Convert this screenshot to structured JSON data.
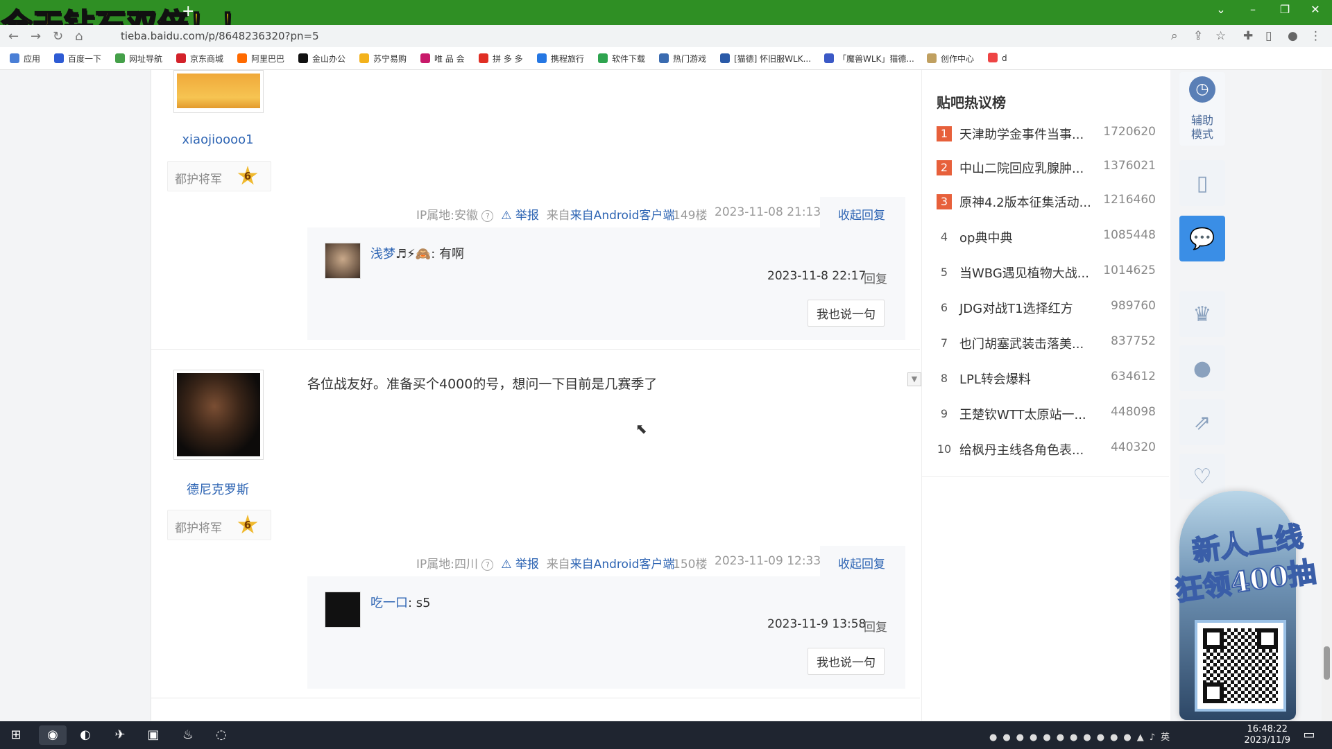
{
  "overlay_banner": "全天钻石双倍！！",
  "browser": {
    "url": "tieba.baidu.com/p/8648236320?pn=5",
    "bookmarks": [
      "应用",
      "百度一下",
      "网址导航",
      "京东商城",
      "阿里巴巴",
      "金山办公",
      "苏宁易购",
      "唯 品 会",
      "拼 多 多",
      "携程旅行",
      "软件下载",
      "热门游戏",
      "[猫德] 怀旧服WLK...",
      "「魔兽WLK」猫德...",
      "创作中心",
      "d"
    ]
  },
  "posts": [
    {
      "username": "xiaojioooo1",
      "badge": "都护将军",
      "level": "6",
      "ip": "IP属地:安徽",
      "report": "举报",
      "client": "来自Android客户端",
      "floor": "149楼",
      "time": "2023-11-08 21:13",
      "collapse": "收起回复",
      "replies": [
        {
          "name": "浅梦",
          "emoji": "♬⚡🙈",
          "text": ": 有啊",
          "time": "2023-11-8 22:17",
          "reply": "回复"
        }
      ],
      "say": "我也说一句"
    },
    {
      "username": "德尼克罗斯",
      "badge": "都护将军",
      "level": "6",
      "content": "各位战友好。准备买个4000的号，想问一下目前是几赛季了",
      "ip": "IP属地:四川",
      "report": "举报",
      "client": "来自Android客户端",
      "floor": "150楼",
      "time": "2023-11-09 12:33",
      "collapse": "收起回复",
      "replies": [
        {
          "name": "吃一口",
          "text": ": s5",
          "time": "2023-11-9 13:58",
          "reply": "回复"
        }
      ],
      "say": "我也说一句"
    }
  ],
  "sidebar": {
    "title": "贴吧热议榜",
    "items": [
      {
        "rank": "1",
        "topic": "天津助学金事件当事...",
        "count": "1720620"
      },
      {
        "rank": "2",
        "topic": "中山二院回应乳腺肿...",
        "count": "1376021"
      },
      {
        "rank": "3",
        "topic": "原神4.2版本征集活动...",
        "count": "1216460"
      },
      {
        "rank": "4",
        "topic": "op典中典",
        "count": "1085448"
      },
      {
        "rank": "5",
        "topic": "当WBG遇见植物大战...",
        "count": "1014625"
      },
      {
        "rank": "6",
        "topic": "JDG对战T1选择红方",
        "count": "989760"
      },
      {
        "rank": "7",
        "topic": "也门胡塞武装击落美...",
        "count": "837752"
      },
      {
        "rank": "8",
        "topic": "LPL转会爆料",
        "count": "634612"
      },
      {
        "rank": "9",
        "topic": "王楚钦WTT太原站一...",
        "count": "448098"
      },
      {
        "rank": "10",
        "topic": "给枫丹主线各角色表...",
        "count": "440320"
      }
    ]
  },
  "toolbar": {
    "assist": "辅助\n模式"
  },
  "ad": {
    "line1": "新人上线",
    "line2": "狂领400抽"
  },
  "clock": {
    "time": "16:48:22",
    "date": "2023/11/9"
  },
  "colors": {
    "accent": "#2d64b3",
    "rank_top": "#e7603b",
    "tabbar": "#2f8f24",
    "feedback": "#3a8ee6"
  }
}
